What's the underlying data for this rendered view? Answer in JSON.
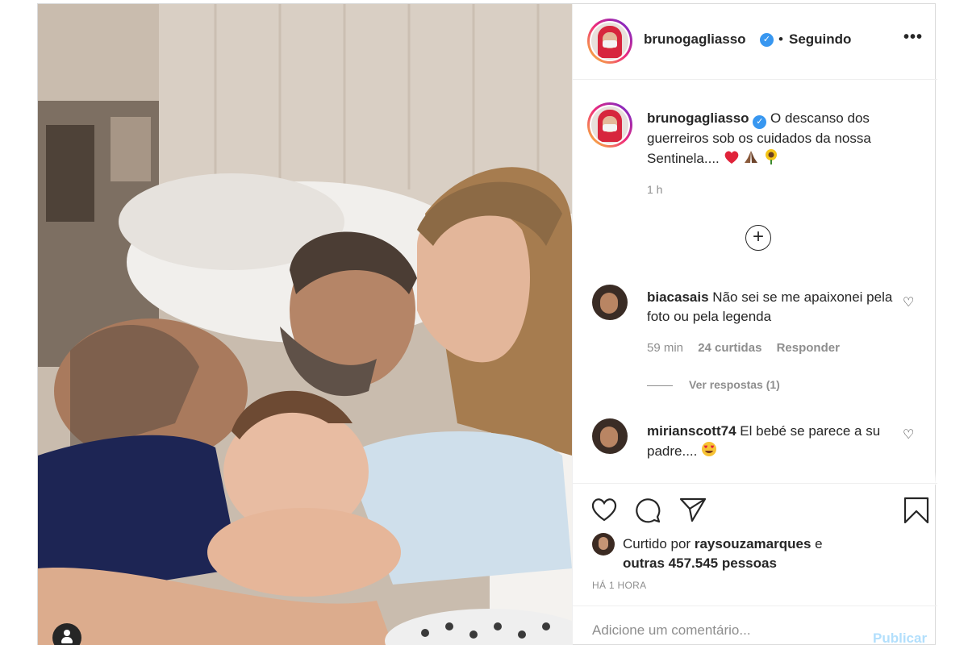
{
  "header": {
    "username": "brunogagliasso",
    "separator": "•",
    "follow_status": "Seguindo",
    "more": "•••"
  },
  "caption": {
    "username": "brunogagliasso",
    "text": "O descanso dos guerreiros sob os cuidados da nossa Sentinela....",
    "emojis": [
      "red-heart",
      "folded-hands",
      "sunflower"
    ],
    "time": "1 h"
  },
  "load_more": "+",
  "comments": [
    {
      "username": "biacasais",
      "text": "Não sei se me apaixonei pela foto ou pela legenda",
      "time": "59 min",
      "likes": "24 curtidas",
      "reply": "Responder",
      "view_replies": "Ver respostas (1)"
    },
    {
      "username": "mirianscott74",
      "text": "El bebé se parece a su padre....",
      "emoji": "heart-eyes"
    }
  ],
  "likes": {
    "prefix": "Curtido por",
    "user": "raysouzamarques",
    "conjunction": "e",
    "others": "outras 457.545 pessoas"
  },
  "post_time": "HÁ 1 HORA",
  "add_comment": {
    "placeholder": "Adicione um comentário...",
    "publish": "Publicar"
  },
  "colors": {
    "accent": "#3897f0",
    "publish_disabled": "#b2dffc",
    "muted": "#8e8e8e"
  }
}
